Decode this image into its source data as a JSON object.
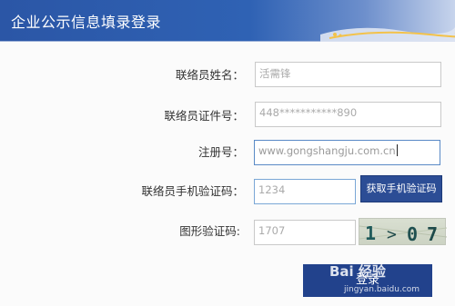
{
  "header": {
    "title": "企业公示信息填录登录"
  },
  "form": {
    "name_label": "联络员姓名：",
    "name_value": "活需锋",
    "id_label": "联络员证件号：",
    "id_value": "448***********890",
    "reg_label": "注册号：",
    "reg_value": "www.gongshangju.com.cn",
    "sms_label": "联络员手机验证码：",
    "sms_value": "1234",
    "sms_button": "获取手机验证码",
    "captcha_label": "图形验证码:",
    "captcha_value": "1707",
    "captcha_image_text": "1>07",
    "login_button": "登录"
  },
  "watermark": {
    "main": "Bai 经验",
    "sub": "jingyan.baidu.com"
  },
  "colors": {
    "header_blue": "#2b56a6",
    "button_blue": "#2c4d95",
    "login_blue": "#22428c"
  }
}
